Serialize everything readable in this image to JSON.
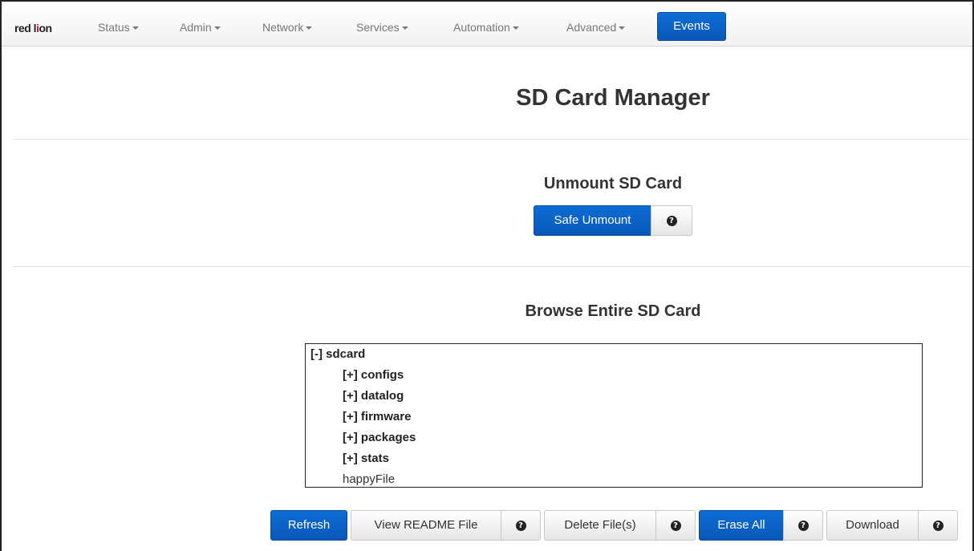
{
  "brand": {
    "text_left": "red l",
    "text_mark": "i",
    "text_right": "on"
  },
  "nav": {
    "items": [
      {
        "label": "Status"
      },
      {
        "label": "Admin"
      },
      {
        "label": "Network"
      },
      {
        "label": "Services"
      },
      {
        "label": "Automation"
      },
      {
        "label": "Advanced"
      }
    ],
    "active": {
      "label": "Events"
    }
  },
  "page": {
    "title": "SD Card Manager"
  },
  "unmount": {
    "title": "Unmount SD Card",
    "safe_unmount_label": "Safe Unmount",
    "help_glyph": "?"
  },
  "browse": {
    "title": "Browse Entire SD Card",
    "root": "[-] sdcard",
    "folders": [
      "[+] configs",
      "[+] datalog",
      "[+] firmware",
      "[+] packages",
      "[+] stats"
    ],
    "files": [
      "happyFile"
    ]
  },
  "actions": {
    "refresh": "Refresh",
    "view_readme": "View README File",
    "delete_files": "Delete File(s)",
    "erase_all": "Erase All",
    "download": "Download",
    "help_glyph": "?"
  },
  "colors": {
    "primary": "#0a5fc4",
    "brand_red": "#c8102e"
  }
}
